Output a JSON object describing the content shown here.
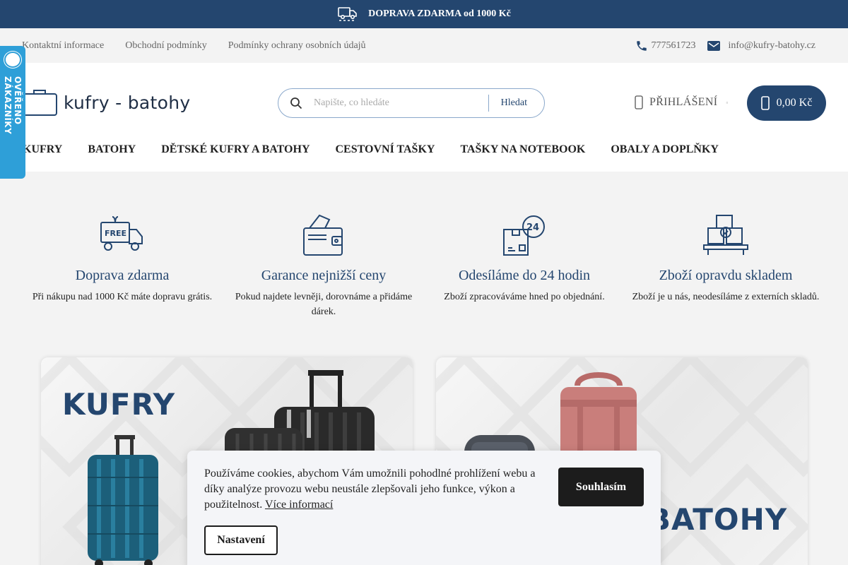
{
  "promo": {
    "text": "DOPRAVA ZDARMA od 1000 Kč",
    "icon": "truck-icon"
  },
  "infobar": {
    "links": [
      "Kontaktní informace",
      "Obchodní podmínky",
      "Podmínky ochrany osobních údajů"
    ],
    "phone": "777561723",
    "email": "info@kufry-batohy.cz"
  },
  "badge": {
    "text": "OVĚŘENO ZÁKAZNÍKY"
  },
  "header": {
    "logo": "kufry - batohy",
    "search_placeholder": "Napište, co hledáte",
    "search_button": "Hledat",
    "login": "PŘIHLÁŠENÍ",
    "cart": "0,00 Kč"
  },
  "nav": [
    "KUFRY",
    "BATOHY",
    "DĚTSKÉ KUFRY A BATOHY",
    "CESTOVNÍ TAŠKY",
    "TAŠKY NA NOTEBOOK",
    "OBALY A DOPLŇKY"
  ],
  "features": [
    {
      "title": "Doprava zdarma",
      "text": "Při nákupu nad 1000 Kč máte dopravu grátis.",
      "icon": "free-delivery-icon"
    },
    {
      "title": "Garance nejnižší ceny",
      "text": "Pokud najdete levněji, dorovnáme a přidáme dárek.",
      "icon": "wallet-icon"
    },
    {
      "title": "Odesíláme do 24 hodin",
      "text": "Zboží zpracováváme hned po objednání.",
      "icon": "box-24h-icon"
    },
    {
      "title": "Zboží opravdu skladem",
      "text": "Zboží je u nás, neodesíláme z externích skladů.",
      "icon": "warehouse-icon"
    }
  ],
  "banners": [
    {
      "title": "KUFRY"
    },
    {
      "title": "BATOHY"
    }
  ],
  "cookie": {
    "text": "Používáme cookies, abychom Vám umožnili pohodlné prohlížení webu a díky analýze provozu webu neustále zlepšovali jeho funkce, výkon a použitelnost.",
    "more": "Více informací",
    "agree": "Souhlasím",
    "settings": "Nastavení"
  },
  "colors": {
    "brand": "#24466f",
    "badge": "#2e9fd8"
  }
}
